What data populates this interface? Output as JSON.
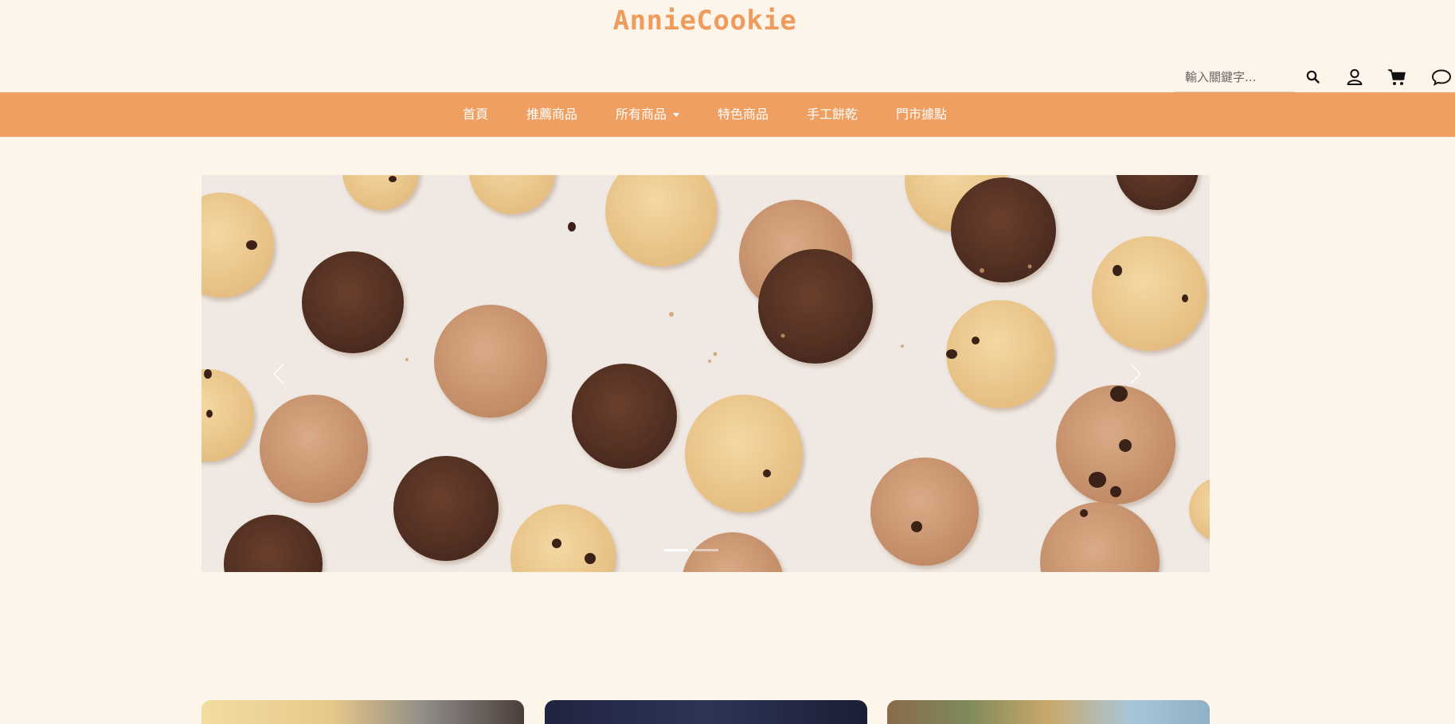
{
  "brand": {
    "name": "AnnieCookie",
    "color": "#ee9c5e"
  },
  "header": {
    "search_placeholder": "輸入關鍵字...",
    "icons": [
      "search-icon",
      "user-icon",
      "cart-icon",
      "chat-icon"
    ]
  },
  "nav": {
    "background": "#ef9f61",
    "items": [
      {
        "label": "首頁"
      },
      {
        "label": "推薦商品"
      },
      {
        "label": "所有商品",
        "dropdown": true
      },
      {
        "label": "特色商品"
      },
      {
        "label": "手工餅乾"
      },
      {
        "label": "門市據點"
      }
    ]
  },
  "carousel": {
    "slide_count": 2,
    "active_slide": 1,
    "image": "cookies-flatlay"
  },
  "cards": [
    {
      "image": "product-card-1"
    },
    {
      "image": "product-card-2"
    },
    {
      "image": "product-card-3"
    }
  ]
}
